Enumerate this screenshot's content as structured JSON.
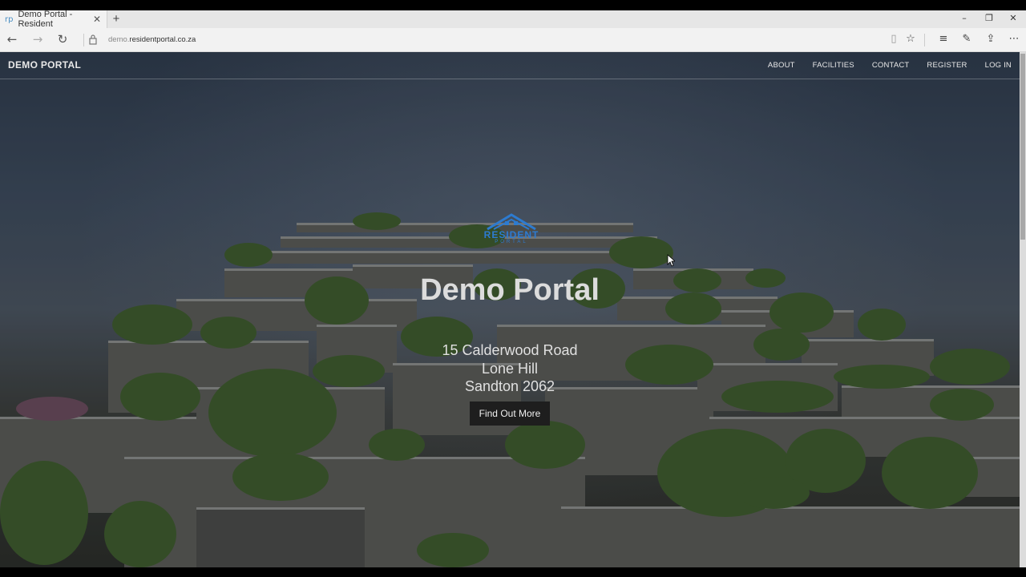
{
  "browser": {
    "tab_title": "Demo Portal - Resident",
    "tab_favicon": "rp",
    "url_prefix": "demo.",
    "url_main": "residentportal.co.za",
    "icons": [
      "back-icon",
      "forward-icon",
      "refresh-icon",
      "lock-icon",
      "reading-view-icon",
      "favorite-star-icon",
      "hub-icon",
      "web-note-icon",
      "share-icon",
      "more-icon"
    ]
  },
  "site": {
    "brand": "DEMO PORTAL",
    "nav": [
      "ABOUT",
      "FACILITIES",
      "CONTACT",
      "REGISTER",
      "LOG IN"
    ],
    "logo_text": "RESIDENT",
    "logo_sub": "PORTAL",
    "title": "Demo Portal",
    "address": [
      "15 Calderwood Road",
      "Lone Hill",
      "Sandton 2062"
    ],
    "cta": "Find Out More"
  },
  "colors": {
    "logo_blue": "#2d7bd0",
    "cta_bg": "#1e1e1e"
  }
}
